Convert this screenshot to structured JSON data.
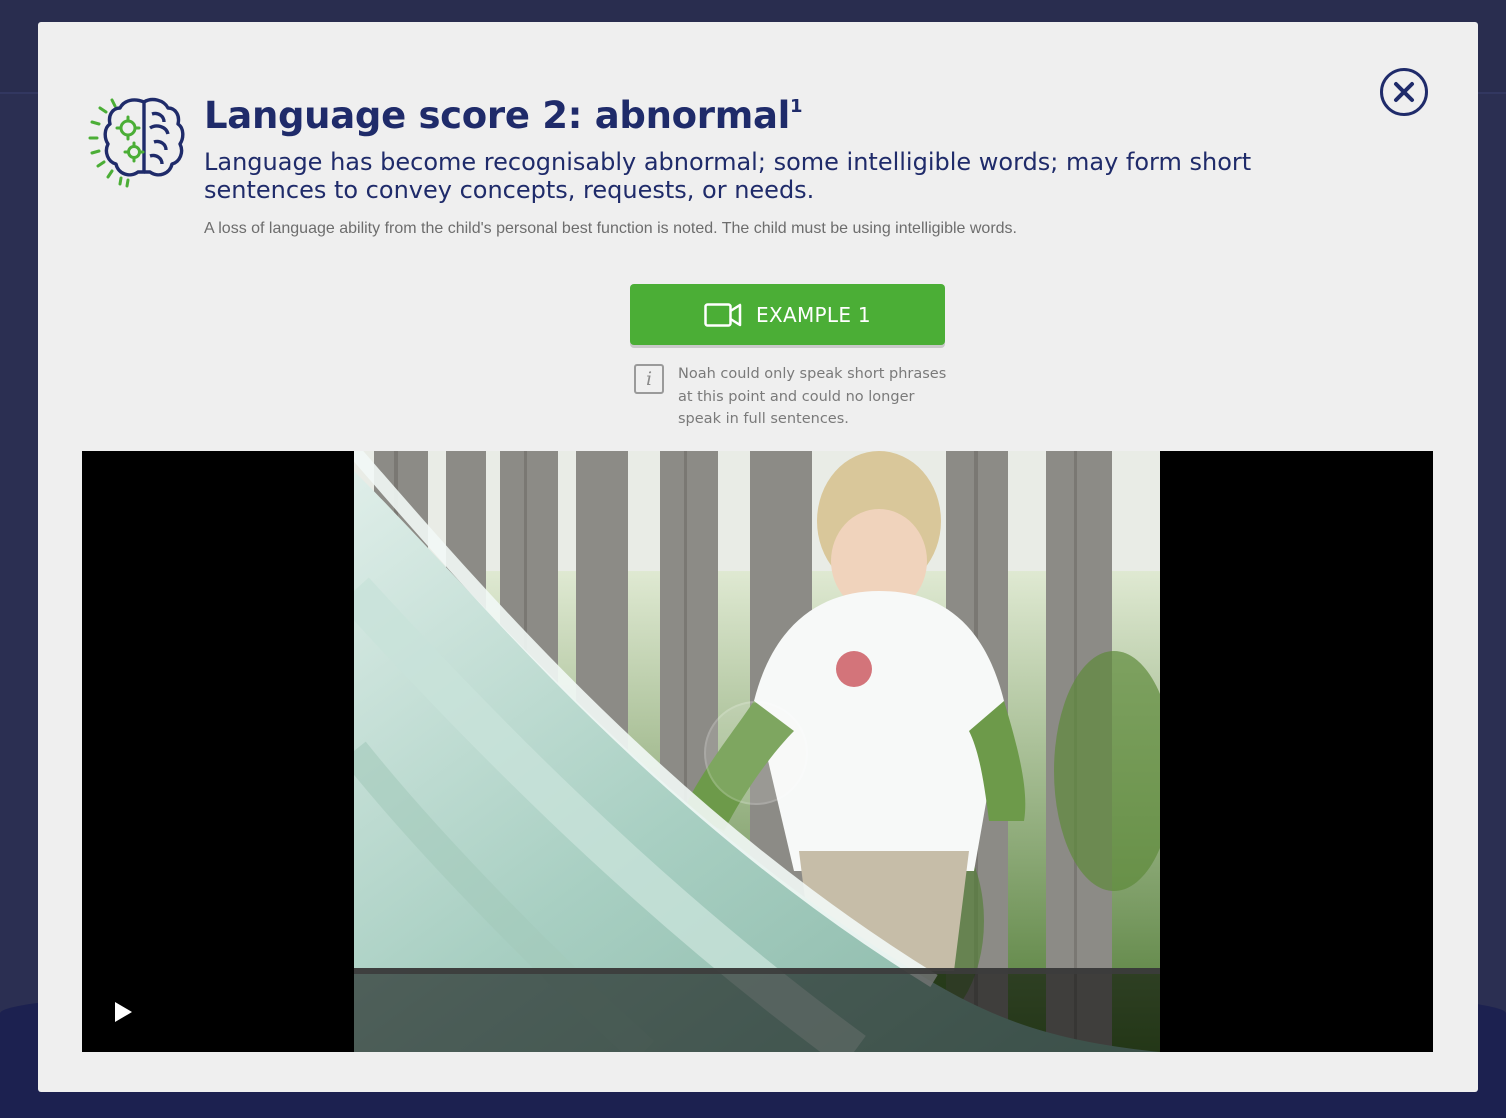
{
  "modal": {
    "title": "Language score 2: abnormal",
    "title_superscript": "1",
    "subtitle": "Language has become recognisably abnormal; some intelligible words; may form short sentences to convey concepts, requests, or needs.",
    "description": "A loss of language ability from the child's personal best function is noted. The child must be using intelligible words.",
    "example_button_label": "EXAMPLE 1",
    "info_text": "Noah could only speak short phrases at this point and could no longer speak in full sentences.",
    "close_icon": "close-icon",
    "header_icon": "brain-gears-icon",
    "example_icon": "video-camera-icon"
  },
  "video": {
    "state": "paused",
    "play_icon": "play-icon"
  },
  "colors": {
    "accent_navy": "#1f2b6a",
    "accent_green": "#4bae36",
    "modal_background": "#efefef",
    "page_background": "#2b2f52"
  }
}
